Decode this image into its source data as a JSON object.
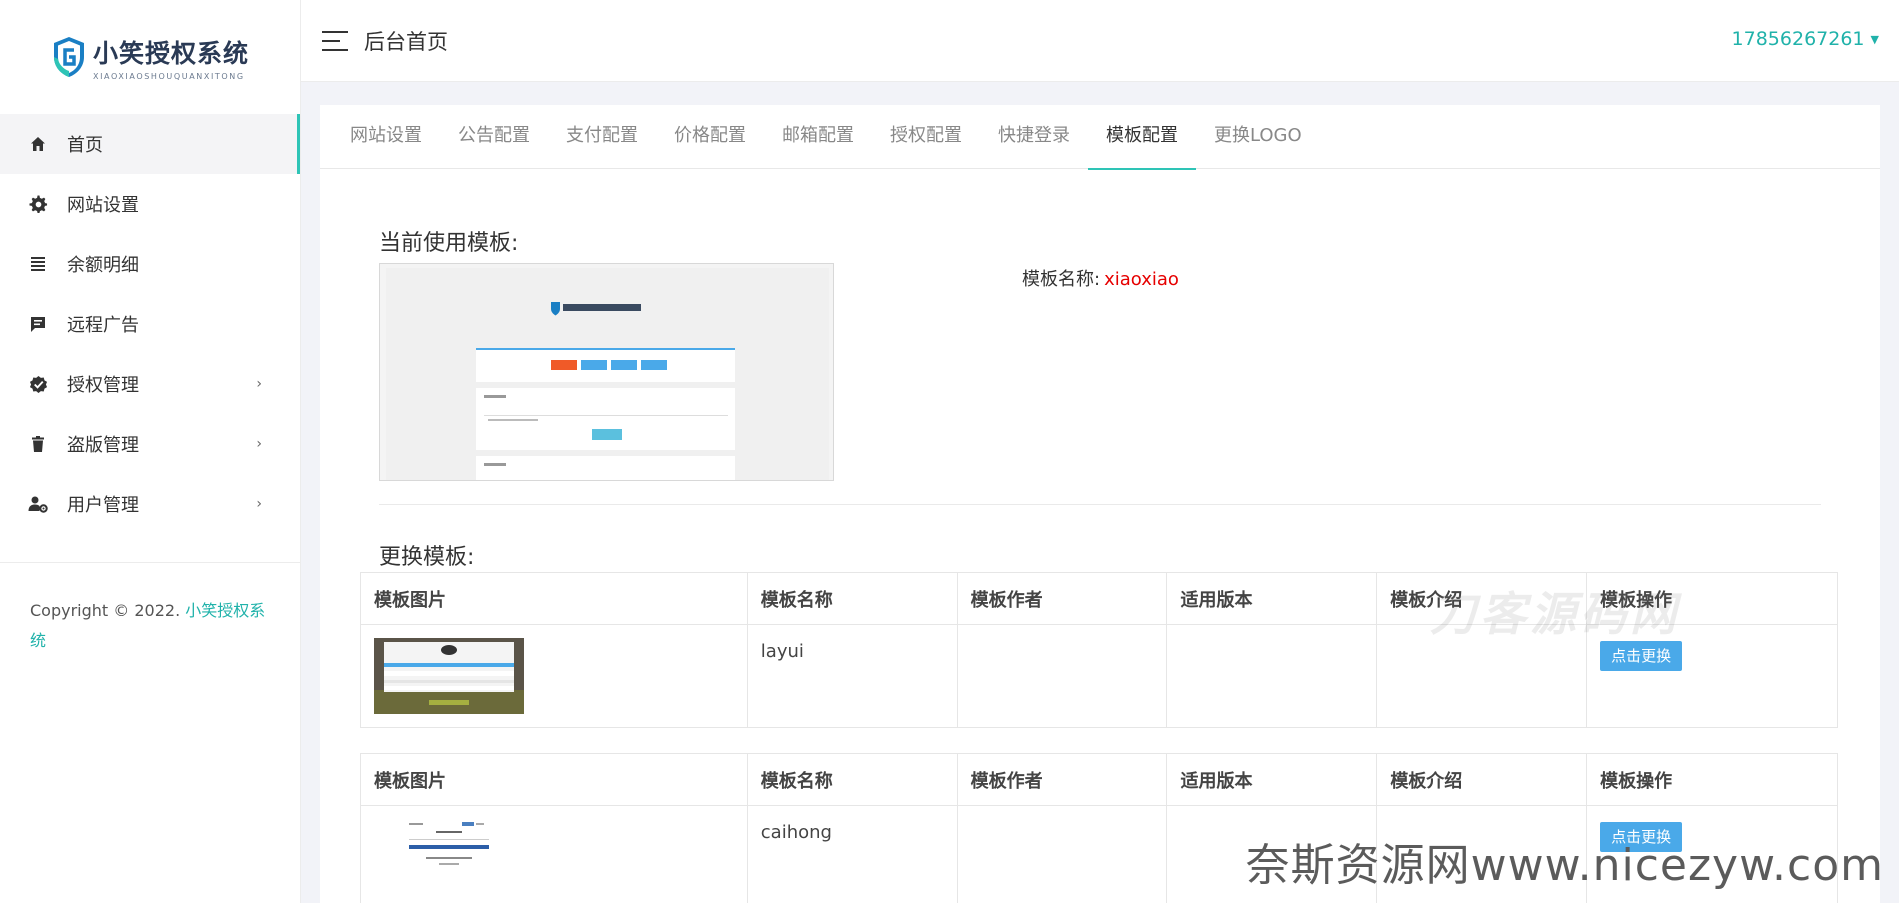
{
  "brand": {
    "title": "小笑授权系统",
    "subtitle": "XIAOXIAOSHOUQUANXITONG"
  },
  "sidebar": {
    "items": [
      {
        "label": "首页",
        "icon": "home-icon",
        "active": true
      },
      {
        "label": "网站设置",
        "icon": "gear-icon"
      },
      {
        "label": "余额明细",
        "icon": "list-icon"
      },
      {
        "label": "远程广告",
        "icon": "message-icon"
      },
      {
        "label": "授权管理",
        "icon": "badge-check-icon",
        "has_children": true
      },
      {
        "label": "盗版管理",
        "icon": "trash-icon",
        "has_children": true
      },
      {
        "label": "用户管理",
        "icon": "user-gear-icon",
        "has_children": true
      }
    ],
    "chevron": "›",
    "copyright_prefix": "Copyright © 2022. ",
    "copyright_link": "小笑授权系统"
  },
  "header": {
    "title": "后台首页",
    "user": "17856267261"
  },
  "tabs": [
    {
      "label": "网站设置"
    },
    {
      "label": "公告配置"
    },
    {
      "label": "支付配置"
    },
    {
      "label": "价格配置"
    },
    {
      "label": "邮箱配置"
    },
    {
      "label": "授权配置"
    },
    {
      "label": "快捷登录"
    },
    {
      "label": "模板配置",
      "active": true
    },
    {
      "label": "更换LOGO"
    }
  ],
  "current": {
    "section_title": "当前使用模板:",
    "name_label": "模板名称:",
    "name_value": "xiaoxiao"
  },
  "change": {
    "section_title": "更换模板:",
    "columns": [
      "模板图片",
      "模板名称",
      "模板作者",
      "适用版本",
      "模板介绍",
      "模板操作"
    ],
    "rows": [
      {
        "name": "layui",
        "author": "",
        "version": "",
        "intro": "",
        "action": "点击更换"
      },
      {
        "name": "caihong",
        "author": "",
        "version": "",
        "intro": "",
        "action": "点击更换"
      }
    ]
  },
  "watermarks": {
    "bottom": "奈斯资源网www.nicezyw.com",
    "table": "刀客源码网"
  },
  "colors": {
    "accent": "#2ec4b6",
    "link": "#20b2aa",
    "button": "#4aa9e9",
    "value_red": "#e60000"
  }
}
